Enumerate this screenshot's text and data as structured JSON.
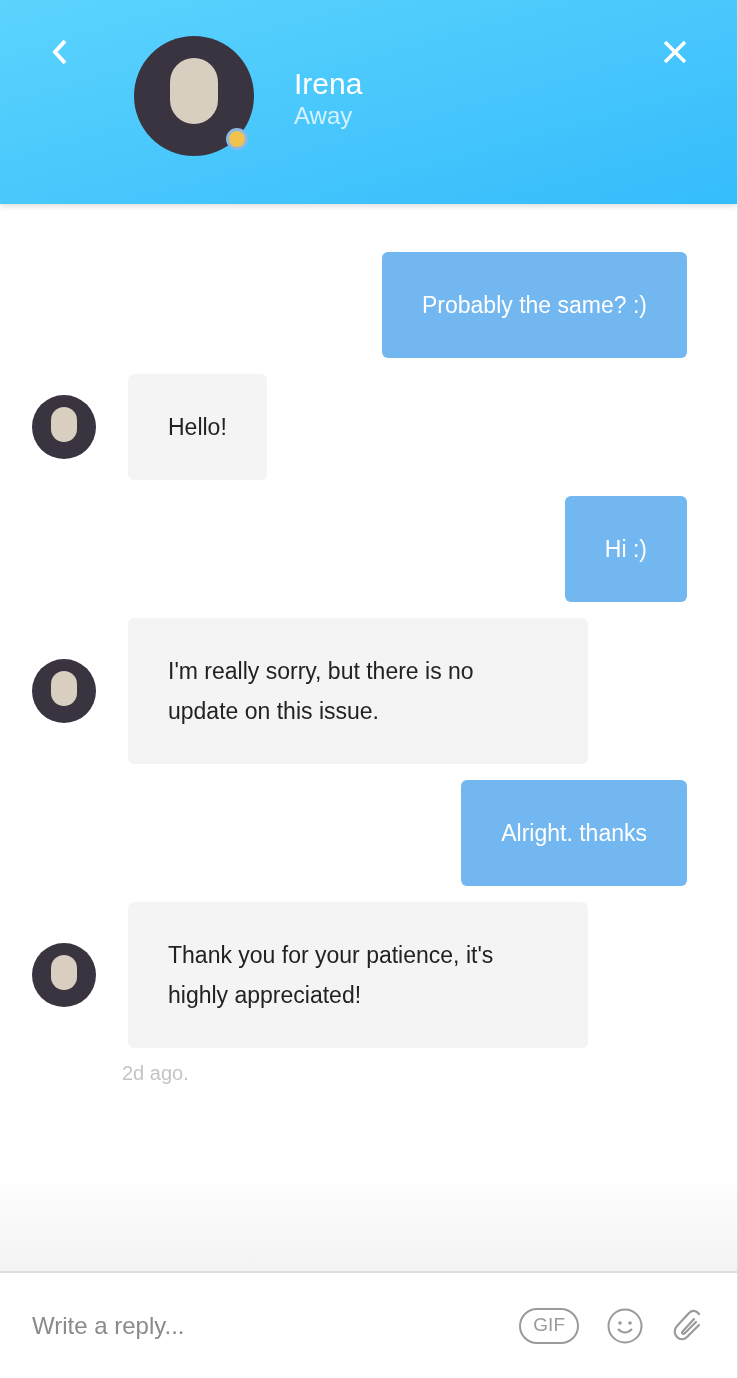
{
  "header": {
    "name": "Irena",
    "status": "Away"
  },
  "messages": [
    {
      "kind": "sent",
      "text": "Probably the same? :)"
    },
    {
      "kind": "received",
      "text": "Hello!"
    },
    {
      "kind": "sent",
      "text": "Hi :)"
    },
    {
      "kind": "received",
      "text": "I'm really sorry, but there is no update on this issue."
    },
    {
      "kind": "sent",
      "text": "Alright. thanks"
    },
    {
      "kind": "received",
      "text": "Thank you for your patience, it's highly appreciated!"
    }
  ],
  "timestamp": "2d ago.",
  "composer": {
    "placeholder": "Write a reply...",
    "gif_label": "GIF"
  }
}
